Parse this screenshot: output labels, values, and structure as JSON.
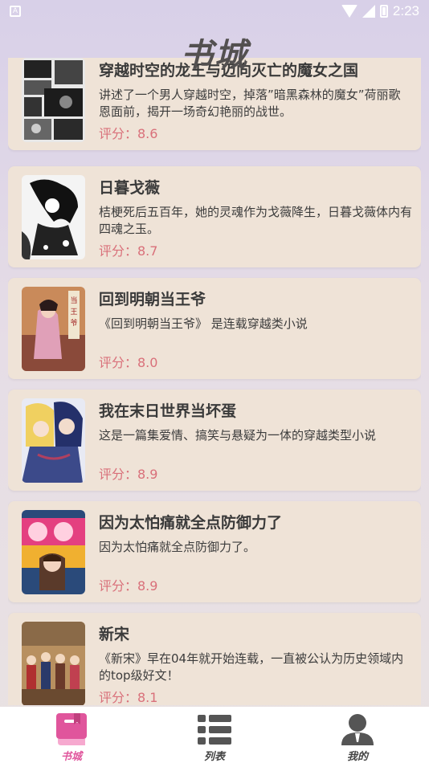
{
  "status_bar": {
    "time": "2:23",
    "icons": [
      "app-notification-icon",
      "wifi-icon",
      "signal-icon",
      "battery-icon"
    ]
  },
  "header": {
    "title": "书城"
  },
  "books": [
    {
      "title": "穿越时空的龙王与迈向灭亡的魔女之国",
      "description": "讲述了一个男人穿越时空，掉落”暗黑森林的魔女”荷丽歌恩面前，揭开一场奇幻艳丽的战世。",
      "score": "评分：8.6"
    },
    {
      "title": "日暮戈薇",
      "description": "桔梗死后五百年，她的灵魂作为戈薇降生，日暮戈薇体内有四魂之玉。",
      "score": "评分：8.7"
    },
    {
      "title": "回到明朝当王爷",
      "description": "《回到明朝当王爷》 是连载穿越类小说",
      "score": "评分：8.0"
    },
    {
      "title": "我在末日世界当坏蛋",
      "description": "这是一篇集爱情、搞笑与悬疑为一体的穿越类型小说",
      "score": "评分：8.9"
    },
    {
      "title": "因为太怕痛就全点防御力了",
      "description": "因为太怕痛就全点防御力了。",
      "score": "评分：8.9"
    },
    {
      "title": "新宋",
      "description": "《新宋》早在04年就开始连载，一直被公认为历史领域内的top级好文！",
      "score": "评分：8.1"
    }
  ],
  "bottom_nav": {
    "items": [
      {
        "label": "书城",
        "icon": "book-icon",
        "active": true
      },
      {
        "label": "列表",
        "icon": "list-icon",
        "active": false
      },
      {
        "label": "我的",
        "icon": "user-icon",
        "active": false
      }
    ],
    "active_color": "#e0559c",
    "inactive_color": "#444444"
  },
  "colors": {
    "card_background": "#efe3d7",
    "score_text": "#d9707a",
    "header_text": "#535050"
  }
}
